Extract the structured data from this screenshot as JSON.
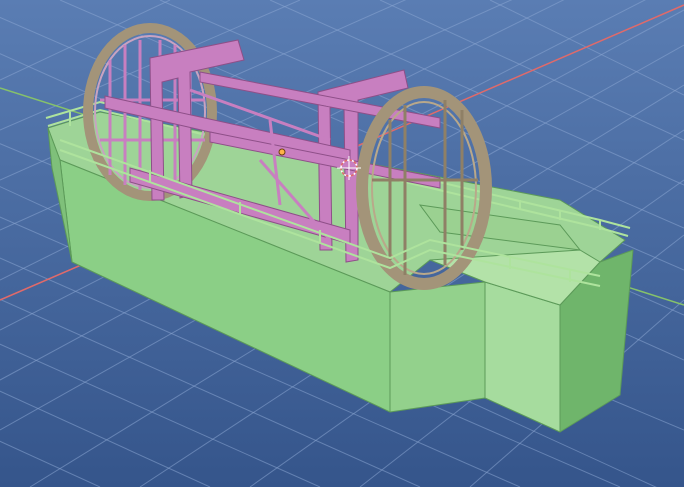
{
  "viewport": {
    "background_color": "#3f5f93",
    "grid_color": "#7f9ccb",
    "x_axis_color": "#e06a6a",
    "y_axis_color": "#86c26a"
  },
  "model": {
    "hull_color": "#8fd08a",
    "frame_color": "#c87fc0",
    "wheel_rim_color": "#a39479",
    "railing_color": "#aee39d"
  },
  "gizmos": {
    "origin_icon": "origin-dot-icon",
    "cursor_icon": "3d-cursor-icon"
  }
}
